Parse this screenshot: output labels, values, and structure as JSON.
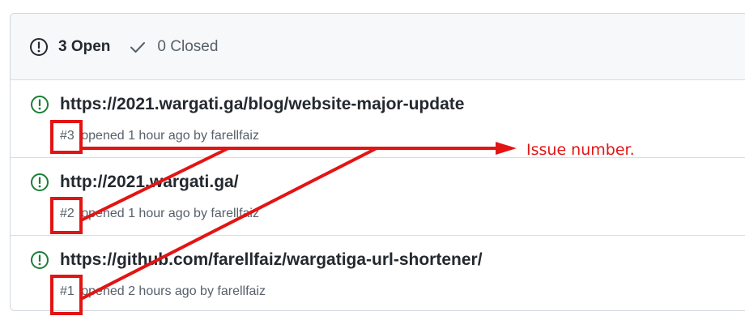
{
  "tabs": {
    "open": {
      "label": "3 Open",
      "icon": "issue-opened-icon"
    },
    "closed": {
      "label": "0 Closed",
      "icon": "check-icon"
    }
  },
  "issues": [
    {
      "title": "https://2021.wargati.ga/blog/website-major-update",
      "number": "#3",
      "opened": "opened 1 hour ago by",
      "author": "farellfaiz"
    },
    {
      "title": "http://2021.wargati.ga/",
      "number": "#2",
      "opened": "opened 1 hour ago by",
      "author": "farellfaiz"
    },
    {
      "title": "https://github.com/farellfaiz/wargatiga-url-shortener/",
      "number": "#1",
      "opened": "opened 2 hours ago by",
      "author": "farellfaiz"
    }
  ],
  "annotation": {
    "label": "Issue number."
  },
  "colors": {
    "open_icon": "#1a7f37",
    "annotation": "#e31414",
    "text_primary": "#24292f",
    "text_muted": "#57606a"
  }
}
